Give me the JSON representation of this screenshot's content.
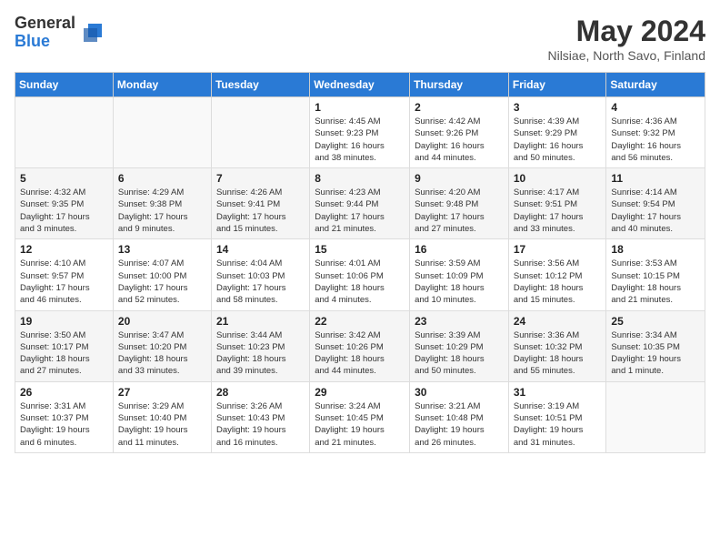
{
  "header": {
    "logo_general": "General",
    "logo_blue": "Blue",
    "month_title": "May 2024",
    "location": "Nilsiae, North Savo, Finland"
  },
  "weekdays": [
    "Sunday",
    "Monday",
    "Tuesday",
    "Wednesday",
    "Thursday",
    "Friday",
    "Saturday"
  ],
  "weeks": [
    [
      {
        "day": "",
        "info": ""
      },
      {
        "day": "",
        "info": ""
      },
      {
        "day": "",
        "info": ""
      },
      {
        "day": "1",
        "info": "Sunrise: 4:45 AM\nSunset: 9:23 PM\nDaylight: 16 hours\nand 38 minutes."
      },
      {
        "day": "2",
        "info": "Sunrise: 4:42 AM\nSunset: 9:26 PM\nDaylight: 16 hours\nand 44 minutes."
      },
      {
        "day": "3",
        "info": "Sunrise: 4:39 AM\nSunset: 9:29 PM\nDaylight: 16 hours\nand 50 minutes."
      },
      {
        "day": "4",
        "info": "Sunrise: 4:36 AM\nSunset: 9:32 PM\nDaylight: 16 hours\nand 56 minutes."
      }
    ],
    [
      {
        "day": "5",
        "info": "Sunrise: 4:32 AM\nSunset: 9:35 PM\nDaylight: 17 hours\nand 3 minutes."
      },
      {
        "day": "6",
        "info": "Sunrise: 4:29 AM\nSunset: 9:38 PM\nDaylight: 17 hours\nand 9 minutes."
      },
      {
        "day": "7",
        "info": "Sunrise: 4:26 AM\nSunset: 9:41 PM\nDaylight: 17 hours\nand 15 minutes."
      },
      {
        "day": "8",
        "info": "Sunrise: 4:23 AM\nSunset: 9:44 PM\nDaylight: 17 hours\nand 21 minutes."
      },
      {
        "day": "9",
        "info": "Sunrise: 4:20 AM\nSunset: 9:48 PM\nDaylight: 17 hours\nand 27 minutes."
      },
      {
        "day": "10",
        "info": "Sunrise: 4:17 AM\nSunset: 9:51 PM\nDaylight: 17 hours\nand 33 minutes."
      },
      {
        "day": "11",
        "info": "Sunrise: 4:14 AM\nSunset: 9:54 PM\nDaylight: 17 hours\nand 40 minutes."
      }
    ],
    [
      {
        "day": "12",
        "info": "Sunrise: 4:10 AM\nSunset: 9:57 PM\nDaylight: 17 hours\nand 46 minutes."
      },
      {
        "day": "13",
        "info": "Sunrise: 4:07 AM\nSunset: 10:00 PM\nDaylight: 17 hours\nand 52 minutes."
      },
      {
        "day": "14",
        "info": "Sunrise: 4:04 AM\nSunset: 10:03 PM\nDaylight: 17 hours\nand 58 minutes."
      },
      {
        "day": "15",
        "info": "Sunrise: 4:01 AM\nSunset: 10:06 PM\nDaylight: 18 hours\nand 4 minutes."
      },
      {
        "day": "16",
        "info": "Sunrise: 3:59 AM\nSunset: 10:09 PM\nDaylight: 18 hours\nand 10 minutes."
      },
      {
        "day": "17",
        "info": "Sunrise: 3:56 AM\nSunset: 10:12 PM\nDaylight: 18 hours\nand 15 minutes."
      },
      {
        "day": "18",
        "info": "Sunrise: 3:53 AM\nSunset: 10:15 PM\nDaylight: 18 hours\nand 21 minutes."
      }
    ],
    [
      {
        "day": "19",
        "info": "Sunrise: 3:50 AM\nSunset: 10:17 PM\nDaylight: 18 hours\nand 27 minutes."
      },
      {
        "day": "20",
        "info": "Sunrise: 3:47 AM\nSunset: 10:20 PM\nDaylight: 18 hours\nand 33 minutes."
      },
      {
        "day": "21",
        "info": "Sunrise: 3:44 AM\nSunset: 10:23 PM\nDaylight: 18 hours\nand 39 minutes."
      },
      {
        "day": "22",
        "info": "Sunrise: 3:42 AM\nSunset: 10:26 PM\nDaylight: 18 hours\nand 44 minutes."
      },
      {
        "day": "23",
        "info": "Sunrise: 3:39 AM\nSunset: 10:29 PM\nDaylight: 18 hours\nand 50 minutes."
      },
      {
        "day": "24",
        "info": "Sunrise: 3:36 AM\nSunset: 10:32 PM\nDaylight: 18 hours\nand 55 minutes."
      },
      {
        "day": "25",
        "info": "Sunrise: 3:34 AM\nSunset: 10:35 PM\nDaylight: 19 hours\nand 1 minute."
      }
    ],
    [
      {
        "day": "26",
        "info": "Sunrise: 3:31 AM\nSunset: 10:37 PM\nDaylight: 19 hours\nand 6 minutes."
      },
      {
        "day": "27",
        "info": "Sunrise: 3:29 AM\nSunset: 10:40 PM\nDaylight: 19 hours\nand 11 minutes."
      },
      {
        "day": "28",
        "info": "Sunrise: 3:26 AM\nSunset: 10:43 PM\nDaylight: 19 hours\nand 16 minutes."
      },
      {
        "day": "29",
        "info": "Sunrise: 3:24 AM\nSunset: 10:45 PM\nDaylight: 19 hours\nand 21 minutes."
      },
      {
        "day": "30",
        "info": "Sunrise: 3:21 AM\nSunset: 10:48 PM\nDaylight: 19 hours\nand 26 minutes."
      },
      {
        "day": "31",
        "info": "Sunrise: 3:19 AM\nSunset: 10:51 PM\nDaylight: 19 hours\nand 31 minutes."
      },
      {
        "day": "",
        "info": ""
      }
    ]
  ]
}
